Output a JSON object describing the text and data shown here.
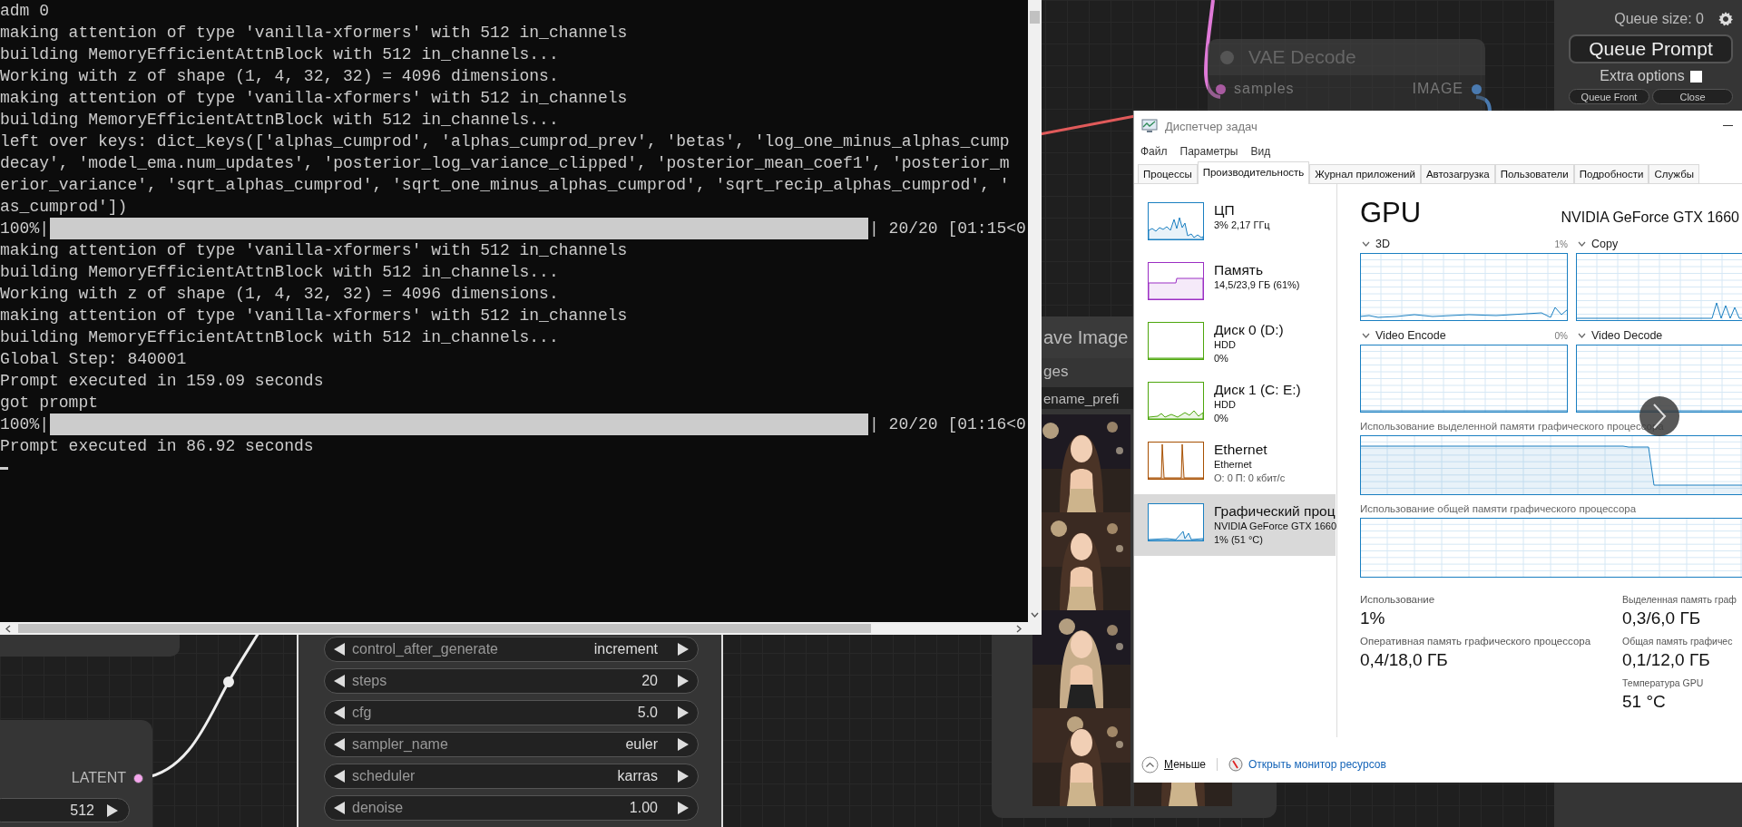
{
  "terminal": {
    "lines": [
      {
        "kind": "text",
        "text": "adm 0"
      },
      {
        "kind": "text",
        "text": "making attention of type 'vanilla-xformers' with 512 in_channels"
      },
      {
        "kind": "text",
        "text": "building MemoryEfficientAttnBlock with 512 in_channels..."
      },
      {
        "kind": "text",
        "text": "Working with z of shape (1, 4, 32, 32) = 4096 dimensions."
      },
      {
        "kind": "text",
        "text": "making attention of type 'vanilla-xformers' with 512 in_channels"
      },
      {
        "kind": "text",
        "text": "building MemoryEfficientAttnBlock with 512 in_channels..."
      },
      {
        "kind": "text",
        "text": "left over keys: dict_keys(['alphas_cumprod', 'alphas_cumprod_prev', 'betas', 'log_one_minus_alphas_cump"
      },
      {
        "kind": "text",
        "text": "decay', 'model_ema.num_updates', 'posterior_log_variance_clipped', 'posterior_mean_coef1', 'posterior_m"
      },
      {
        "kind": "text",
        "text": "erior_variance', 'sqrt_alphas_cumprod', 'sqrt_one_minus_alphas_cumprod', 'sqrt_recip_alphas_cumprod', '"
      },
      {
        "kind": "text",
        "text": "as_cumprod'])"
      },
      {
        "kind": "progress",
        "prefix": "100%|",
        "level": 1,
        "suffix": "| 20/20 [01:15<0"
      },
      {
        "kind": "text",
        "text": "making attention of type 'vanilla-xformers' with 512 in_channels"
      },
      {
        "kind": "text",
        "text": "building MemoryEfficientAttnBlock with 512 in_channels..."
      },
      {
        "kind": "text",
        "text": "Working with z of shape (1, 4, 32, 32) = 4096 dimensions."
      },
      {
        "kind": "text",
        "text": "making attention of type 'vanilla-xformers' with 512 in_channels"
      },
      {
        "kind": "text",
        "text": "building MemoryEfficientAttnBlock with 512 in_channels..."
      },
      {
        "kind": "text",
        "text": "Global Step: 840001"
      },
      {
        "kind": "text",
        "text": "Prompt executed in 159.09 seconds"
      },
      {
        "kind": "text",
        "text": "got prompt"
      },
      {
        "kind": "progress",
        "prefix": "100%|",
        "level": 1,
        "suffix": "| 20/20 [01:16<0"
      },
      {
        "kind": "text",
        "text": "Prompt executed in 86.92 seconds"
      },
      {
        "kind": "cursor"
      }
    ]
  },
  "canvas": {
    "vae_node": {
      "title": "VAE Decode",
      "input": "samples",
      "output": "IMAGE"
    },
    "save_node": {
      "title": "ave Image",
      "output": "ges",
      "widget": "ename_prefi"
    },
    "sampler_widgets": [
      {
        "name": "control_after_generate",
        "value": "increment"
      },
      {
        "name": "steps",
        "value": "20"
      },
      {
        "name": "cfg",
        "value": "5.0"
      },
      {
        "name": "sampler_name",
        "value": "euler"
      },
      {
        "name": "scheduler",
        "value": "karras"
      },
      {
        "name": "denoise",
        "value": "1.00"
      }
    ],
    "latent_node": {
      "output": "LATENT",
      "widget_value": "512"
    },
    "queue_panel": {
      "queue_size": "Queue size: 0",
      "queue_button": "Queue Prompt",
      "extra_options": {
        "label": "Extra options",
        "checked": false
      },
      "buttons": [
        "Queue Front",
        "Close"
      ]
    }
  },
  "task_manager": {
    "title": "Диспетчер задач",
    "menu": [
      "Файл",
      "Параметры",
      "Вид"
    ],
    "tabs": [
      {
        "label": "Процессы",
        "selected": false
      },
      {
        "label": "Производительность",
        "selected": true
      },
      {
        "label": "Журнал приложений",
        "selected": false
      },
      {
        "label": "Автозагрузка",
        "selected": false
      },
      {
        "label": "Пользователи",
        "selected": false
      },
      {
        "label": "Подробности",
        "selected": false
      },
      {
        "label": "Службы",
        "selected": false
      }
    ],
    "sidebar": [
      {
        "title": "ЦП",
        "lines": [
          "3% 2,17 ГГц"
        ],
        "color": "#1a7fc1",
        "selected": false
      },
      {
        "title": "Память",
        "lines": [
          "14,5/23,9 ГБ (61%)"
        ],
        "color": "#9b2ec4",
        "selected": false
      },
      {
        "title": "Диск 0 (D:)",
        "lines": [
          "HDD",
          "0%"
        ],
        "color": "#4da60c",
        "selected": false
      },
      {
        "title": "Диск 1 (C: E:)",
        "lines": [
          "HDD",
          "0%"
        ],
        "color": "#4da60c",
        "selected": false
      },
      {
        "title": "Ethernet",
        "lines": [
          "Ethernet",
          "О: 0 П: 0 кбит/с"
        ],
        "color": "#a74f01",
        "selected": false
      },
      {
        "title": "Графический проц",
        "lines": [
          "NVIDIA GeForce GTX 1660",
          "1% (51 °C)"
        ],
        "color": "#1a7fc1",
        "selected": true
      }
    ],
    "heading": "GPU",
    "device": "NVIDIA GeForce GTX 1660",
    "engines": [
      {
        "name": "3D",
        "value": "1%"
      },
      {
        "name": "Copy"
      },
      {
        "name": "Video Encode",
        "value": "0%"
      },
      {
        "name": "Video Decode"
      }
    ],
    "memory_graphs": [
      "Использование выделенной памяти графического процессора",
      "Использование общей памяти графического процессора"
    ],
    "stats_left": [
      {
        "label": "Использование",
        "value": "1%"
      },
      {
        "label": "Оперативная память графического процессора",
        "value": "0,4/18,0 ГБ"
      }
    ],
    "stats_right": [
      {
        "label": "Выделенная память граф",
        "value": "0,3/6,0 ГБ"
      },
      {
        "label": "Общая память графичес",
        "value": "0,1/12,0 ГБ"
      },
      {
        "label": "Температура GPU",
        "value": "51 °C"
      }
    ],
    "footer": {
      "less": "Меньше",
      "link": "Открыть монитор ресурсов"
    }
  }
}
